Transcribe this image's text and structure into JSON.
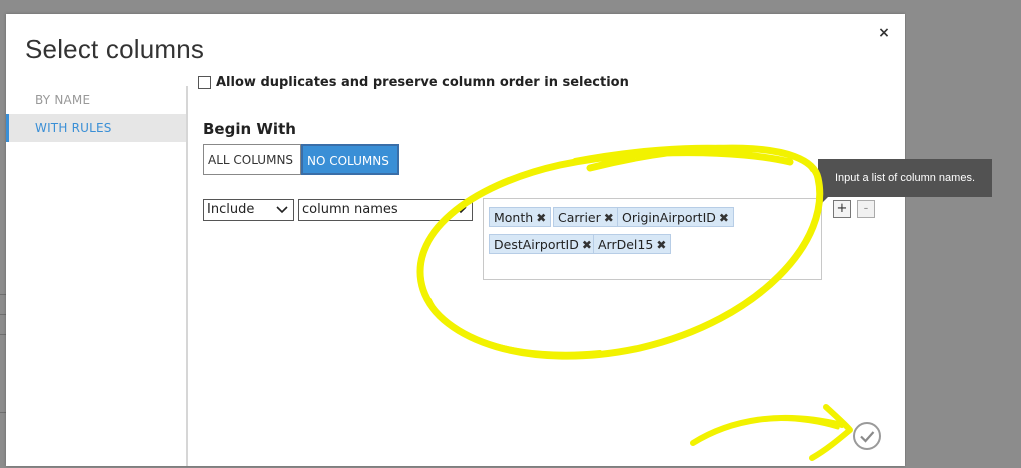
{
  "dialog": {
    "title": "Select columns",
    "close_label": "×"
  },
  "sidebar": {
    "items": [
      {
        "label": "BY NAME",
        "active": false
      },
      {
        "label": "WITH RULES",
        "active": true
      }
    ]
  },
  "options": {
    "allow_duplicates_label": "Allow duplicates and preserve column order in selection",
    "allow_duplicates_checked": false
  },
  "begin_with": {
    "label": "Begin With",
    "buttons": [
      {
        "label": "ALL COLUMNS",
        "selected": false
      },
      {
        "label": "NO COLUMNS",
        "selected": true
      }
    ]
  },
  "rule": {
    "action_value": "Include",
    "mode_value": "column names",
    "tags": [
      "Month",
      "Carrier",
      "OriginAirportID",
      "DestAirportID",
      "ArrDel15"
    ],
    "tag_remove_glyph": "✖",
    "add_label": "+",
    "remove_label": "-"
  },
  "tooltip": {
    "text": "Input a list of column names."
  },
  "icons": {
    "checkmark": "checkmark-icon",
    "close": "close-icon",
    "dropdown": "chevron-down-icon"
  },
  "colors": {
    "accent": "#3a8fd6",
    "tag_bg": "#d7e7f6",
    "annotation": "#f2f200",
    "tooltip_bg": "#525252"
  }
}
